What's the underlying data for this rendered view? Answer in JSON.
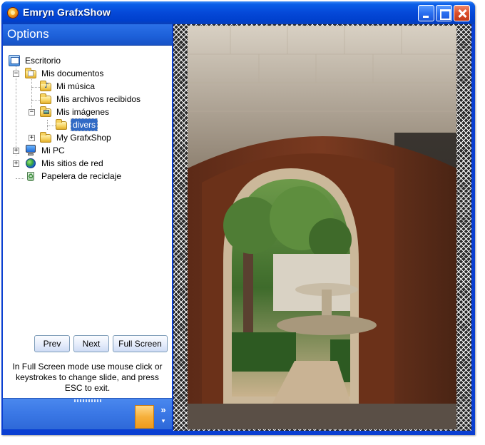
{
  "window": {
    "title": "Emryn GrafxShow"
  },
  "titlebar_buttons": [
    "minimize",
    "maximize",
    "close"
  ],
  "sidebar": {
    "header": "Options"
  },
  "tree": [
    {
      "label": "Escritorio",
      "icon": "desktop-icon",
      "level": 0,
      "expander": null
    },
    {
      "label": "Mis documentos",
      "icon": "documents-folder-icon",
      "level": 1,
      "expander": "−"
    },
    {
      "label": "Mi música",
      "icon": "music-folder-icon",
      "level": 2,
      "expander": null
    },
    {
      "label": "Mis archivos recibidos",
      "icon": "folder-icon",
      "level": 2,
      "expander": null
    },
    {
      "label": "Mis imágenes",
      "icon": "pictures-folder-icon",
      "level": 2,
      "expander": "−"
    },
    {
      "label": "divers",
      "icon": "folder-open-icon",
      "level": 3,
      "expander": null,
      "selected": true
    },
    {
      "label": "My GrafxShop",
      "icon": "folder-icon",
      "level": 2,
      "expander": "+"
    },
    {
      "label": "Mi PC",
      "icon": "computer-icon",
      "level": 1,
      "expander": "+"
    },
    {
      "label": "Mis sitios de red",
      "icon": "network-icon",
      "level": 1,
      "expander": "+"
    },
    {
      "label": "Papelera de reciclaje",
      "icon": "recycle-bin-icon",
      "level": 1,
      "expander": null
    }
  ],
  "controls": {
    "prev_label": "Prev",
    "next_label": "Next",
    "fullscreen_label": "Full Screen"
  },
  "help_text": "In Full Screen mode use mouse click or keystrokes to change slide, and press ESC to exit.",
  "bottom_bar": {
    "chevron": "»"
  },
  "colors": {
    "title_blue": "#0548d8",
    "selection": "#316ac5",
    "accent_orange": "#f6b03c"
  }
}
